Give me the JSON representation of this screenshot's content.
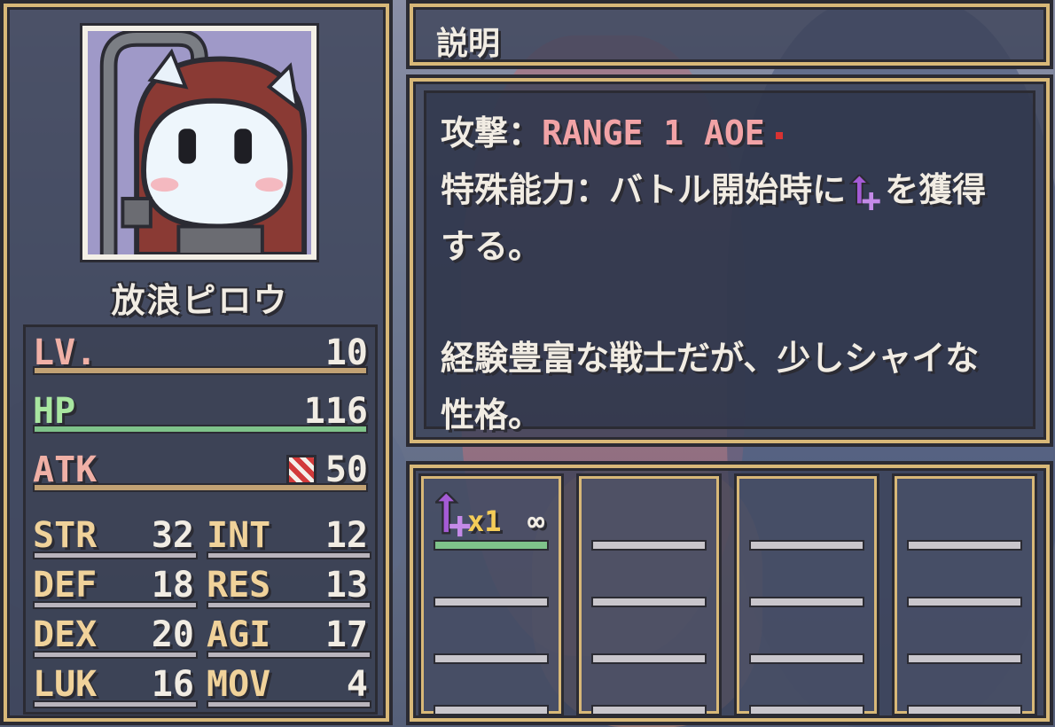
{
  "character": {
    "name": "放浪ピロウ"
  },
  "stats": {
    "lv": {
      "label": "LV.",
      "value": "10"
    },
    "hp": {
      "label": "HP",
      "value": "116"
    },
    "atk": {
      "label": "ATK",
      "value": "50"
    },
    "grid": [
      {
        "label": "STR",
        "value": "32"
      },
      {
        "label": "INT",
        "value": "12"
      },
      {
        "label": "DEF",
        "value": "18"
      },
      {
        "label": "RES",
        "value": "13"
      },
      {
        "label": "DEX",
        "value": "20"
      },
      {
        "label": "AGI",
        "value": "17"
      },
      {
        "label": "LUK",
        "value": "16"
      },
      {
        "label": "MOV",
        "value": "4"
      }
    ]
  },
  "description": {
    "title": "説明",
    "attack_label": "攻撃：",
    "attack_value": "RANGE 1 AOE",
    "ability_label": "特殊能力：",
    "ability_text_before": "バトル開始時に",
    "ability_text_after": "を獲得",
    "ability_text_line2": "する。",
    "flavor_line1": "経験豊富な戦士だが、少しシャイな",
    "flavor_line2": "性格。"
  },
  "inventory": {
    "slots": [
      {
        "count": "x1",
        "duration": "∞",
        "icon": "purple-sparkle-arrow-icon"
      },
      {},
      {},
      {}
    ]
  },
  "colors": {
    "frame_gold": "#d8b878",
    "lv_bar": "#c2a274",
    "hp_bar": "#7fc38a",
    "atk_bar": "#c2a274",
    "lv_label": "#f0b0a6",
    "hp_label": "#a8e6a0",
    "atk_label": "#f0b0a6",
    "attack_value": "#f2a3a6",
    "buff_purple": "#a55bd6"
  }
}
